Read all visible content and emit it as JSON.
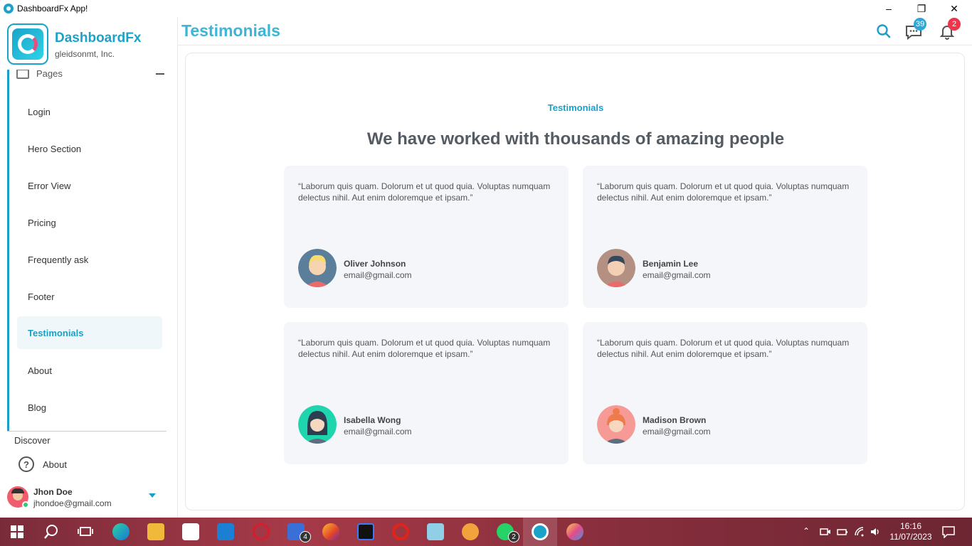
{
  "window": {
    "title": "DashboardFx App!"
  },
  "brand": {
    "name": "DashboardFx",
    "org": "gleidsonmt, Inc."
  },
  "sidebar": {
    "group_label": "Pages",
    "items": [
      {
        "label": "Login"
      },
      {
        "label": "Hero Section"
      },
      {
        "label": "Error View"
      },
      {
        "label": "Pricing"
      },
      {
        "label": "Frequently ask"
      },
      {
        "label": "Footer"
      },
      {
        "label": "Testimonials",
        "active": true
      },
      {
        "label": "About"
      },
      {
        "label": "Blog"
      }
    ],
    "discover_label": "Discover",
    "about_label": "About",
    "user": {
      "name": "Jhon Doe",
      "email": "jhondoe@gmail.com"
    }
  },
  "header": {
    "title": "Testimonials",
    "messages_badge": "39",
    "notifications_badge": "2"
  },
  "main": {
    "eyebrow": "Testimonials",
    "headline": "We have worked with thousands of amazing people",
    "testimonials": [
      {
        "quote": "“Laborum quis quam. Dolorum et ut quod quia. Voluptas numquam delectus nihil. Aut enim doloremque et ipsam.”",
        "name": "Oliver Johnson",
        "email": "email@gmail.com"
      },
      {
        "quote": "“Laborum quis quam. Dolorum et ut quod quia. Voluptas numquam delectus nihil. Aut enim doloremque et ipsam.”",
        "name": "Benjamin Lee",
        "email": "email@gmail.com"
      },
      {
        "quote": "“Laborum quis quam. Dolorum et ut quod quia. Voluptas numquam delectus nihil. Aut enim doloremque et ipsam.”",
        "name": "Isabella Wong",
        "email": "email@gmail.com"
      },
      {
        "quote": "“Laborum quis quam. Dolorum et ut quod quia. Voluptas numquam delectus nihil. Aut enim doloremque et ipsam.”",
        "name": "Madison Brown",
        "email": "email@gmail.com"
      }
    ]
  },
  "taskbar": {
    "badge_todo": "4",
    "badge_whatsapp": "2",
    "time": "16:16",
    "date": "11/07/2023"
  },
  "colors": {
    "accent": "#1a9fc7",
    "title_accent": "#3cb6d6",
    "badge_blue": "#2aa8d8",
    "badge_red": "#f0344a"
  }
}
